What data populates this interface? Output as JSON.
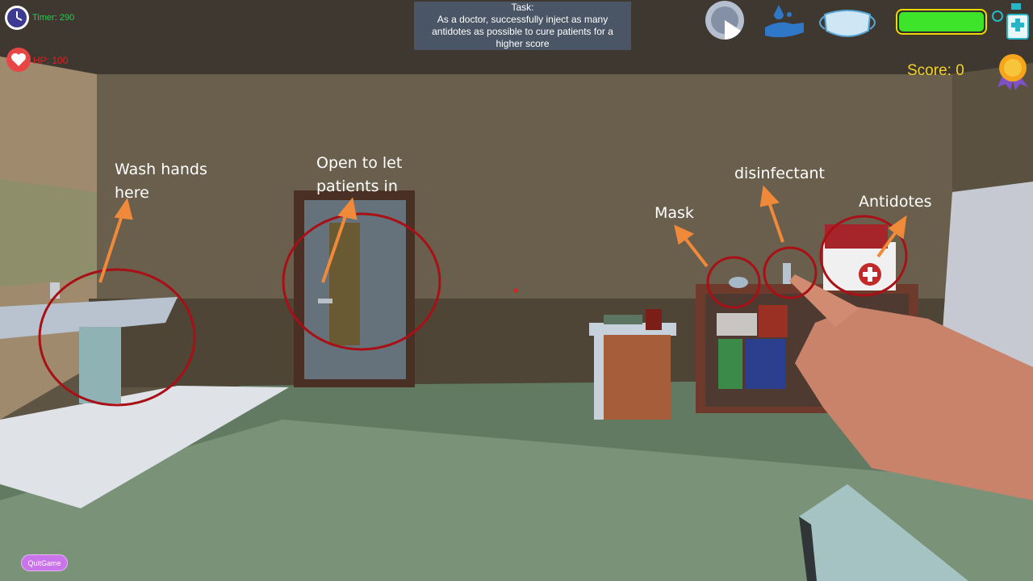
{
  "hud": {
    "timer_label": "Timer:",
    "timer_value": "290",
    "hp_label": "HP:",
    "hp_value": "100",
    "score_label": "Score:",
    "score_value": "0",
    "health_level": 1.0
  },
  "task": {
    "heading": "Task:",
    "line1": "As a doctor, successfully inject as many",
    "line2": "antidotes as possible to cure patients for a",
    "line3": "higher score"
  },
  "annotations": {
    "wash_hands": "Wash hands\nhere",
    "open_door": "Open to let\npatients in",
    "mask": "Mask",
    "disinfectant": "disinfectant",
    "antidotes": "Antidotes"
  },
  "buttons": {
    "quit": "QuitGame"
  },
  "colors": {
    "annotation_circle": "#a81016",
    "annotation_arrow": "#f08a3a",
    "health": "#3ee42a",
    "score": "#f2d22b"
  }
}
